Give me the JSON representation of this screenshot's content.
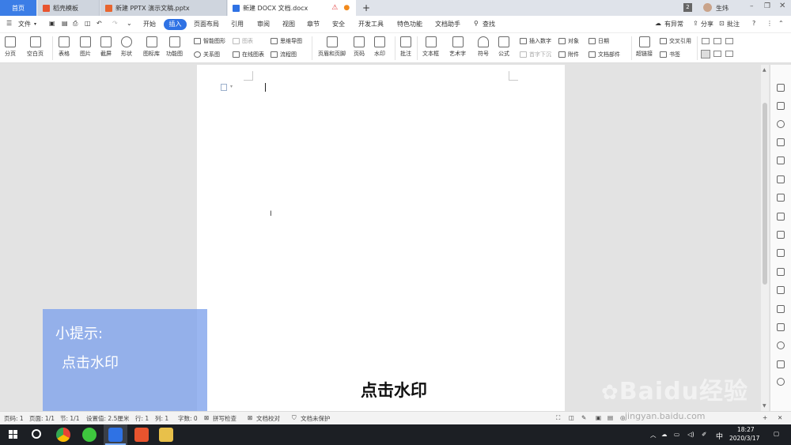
{
  "tabs": [
    {
      "label": "首页",
      "color": "#3b7de6"
    },
    {
      "label": "稻壳模板",
      "icon": "docer-icon",
      "color": "#e8542e"
    },
    {
      "label": "新建 PPTX 演示文稿.pptx",
      "icon": "pptx-icon",
      "color": "#e8652f"
    },
    {
      "label": "新建 DOCX 文档.docx",
      "icon": "docx-icon",
      "color": "#2f72e4"
    }
  ],
  "new_tab_label": "+",
  "window": {
    "badge": "2",
    "user": "生炜"
  },
  "menu": {
    "file": "文件",
    "items": [
      "开始",
      "插入",
      "页面布局",
      "引用",
      "审阅",
      "视图",
      "章节",
      "安全",
      "开发工具",
      "特色功能",
      "文档助手"
    ],
    "search": "查找",
    "right": [
      "有异常",
      "分享",
      "批注"
    ]
  },
  "ribbon": {
    "big": [
      "分页",
      "空白页",
      "表格",
      "图片",
      "截屏",
      "形状",
      "图标库",
      "功能图",
      "页眉和页脚",
      "页码",
      "水印",
      "批注",
      "文本框",
      "艺术字",
      "符号",
      "公式",
      "超链接"
    ],
    "small": [
      "智能图形",
      "图表",
      "思维导图",
      "关系图",
      "在线图表",
      "流程图",
      "插入数字",
      "对象",
      "日期",
      "首字下沉",
      "附件",
      "文档部件",
      "交叉引用",
      "书签"
    ]
  },
  "hint": {
    "title": "小提示:",
    "body": "点击水印"
  },
  "caption": "点击水印",
  "status": {
    "page_no": "页码: 1",
    "pages": "页面: 1/1",
    "section": "节: 1/1",
    "setting": "设置值: 2.5厘米",
    "row": "行: 1",
    "col": "列: 1",
    "words": "字数: 0",
    "spell": "拼写检查",
    "proof": "文档校对",
    "protect": "文档未保护"
  },
  "taskbar": {
    "time": "18:27",
    "date": "2020/3/17",
    "ime": "中"
  },
  "watermark": {
    "brand": "Baidu经验",
    "url": "jingyan.baidu.com"
  }
}
